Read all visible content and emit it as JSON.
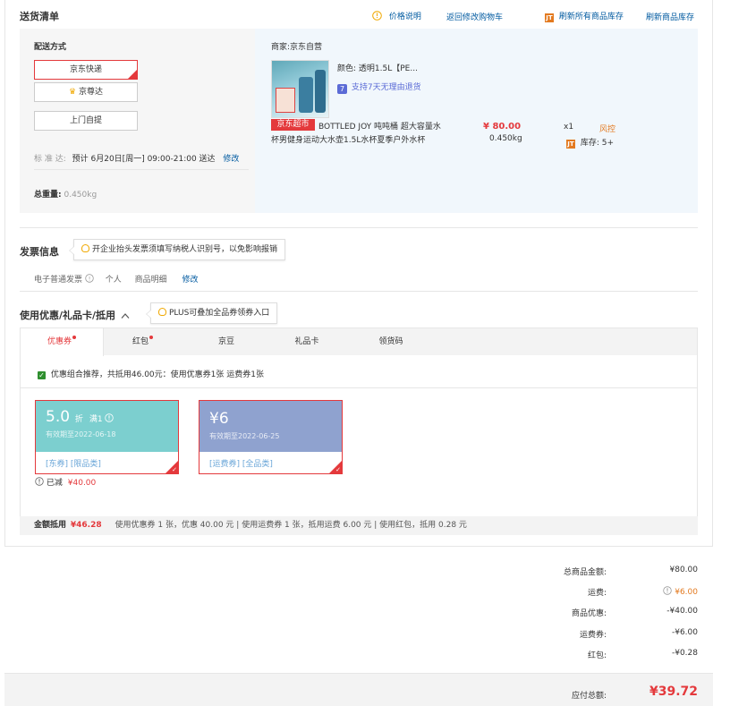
{
  "delivery": {
    "title": "送货清单",
    "links": {
      "price_desc": "价格说明",
      "back_to_cart": "返回修改购物车",
      "refresh_all_stock": "刷新所有商品库存",
      "refresh_stock": "刷新商品库存"
    },
    "shipping": {
      "label": "配送方式",
      "options": [
        "京东快递",
        "京尊达",
        "上门自提"
      ],
      "standard_label": "标 准 达:",
      "standard_time": "预计 6月20日[周一] 09:00-21:00 送达",
      "modify": "修改",
      "weight_label": "总重量:",
      "weight_value": "0.450kg"
    },
    "merchant": {
      "label": "商家:京东自营",
      "product": {
        "color_label": "颜色:",
        "color_value": "透明1.5L【PE...",
        "return_policy": "支持7天无理由退货",
        "badge": "京东超市",
        "name": "BOTTLED JOY 吨吨桶 超大容量水杯男健身运动大水壶1.5L水杯夏季户外水杯",
        "price": "¥ 80.00",
        "weight": "0.450kg",
        "qty": "x1",
        "risk": "风控",
        "stock_label": "库存:",
        "stock_value": "5+"
      }
    }
  },
  "invoice": {
    "title": "发票信息",
    "tip": "开企业抬头发票须填写纳税人识别号，以免影响报销",
    "type": "电子普通发票",
    "person": "个人",
    "detail": "商品明细",
    "modify": "修改"
  },
  "discount": {
    "title": "使用优惠/礼品卡/抵用",
    "tip": "PLUS可叠加全品券领券入口",
    "tabs": [
      "优惠券",
      "红包",
      "京豆",
      "礼品卡",
      "领货码"
    ],
    "combo_text": "优惠组合推荐，共抵用46.00元：使用优惠券1张 运费券1张",
    "coupons": [
      {
        "amount": "5.0",
        "unit": "折",
        "condition": "满1",
        "expiry": "有效期至2022-06-18",
        "tags": "[东券]  [限品类]",
        "color": "#7ccfcf"
      },
      {
        "amount": "¥6",
        "unit": "",
        "condition": "",
        "expiry": "有效期至2022-06-25",
        "tags": "[运费券]  [全品类]",
        "color": "#8fa2cf"
      }
    ],
    "reduced_label": "已减",
    "reduced_value": "¥40.00",
    "summary_label": "金额抵用",
    "summary_value": "¥46.28",
    "summary_detail": "使用优惠券 1 张，优惠 40.00 元  | 使用运费券 1 张，抵用运费 6.00 元  | 使用红包，抵用 0.28 元"
  },
  "totals": {
    "rows": [
      {
        "label": "总商品金额:",
        "value": "¥80.00"
      },
      {
        "label": "运费:",
        "value": "¥6.00"
      },
      {
        "label": "商品优惠:",
        "value": "-¥40.00"
      },
      {
        "label": "运费券:",
        "value": "-¥6.00"
      },
      {
        "label": "红包:",
        "value": "-¥0.28"
      }
    ],
    "pay_label": "应付总额:",
    "pay_value": "¥39.72"
  },
  "colors": {
    "accent": "#e4393c",
    "link": "#005aa0",
    "merchant_bg": "#f1f7fc",
    "orange": "#e37a20"
  }
}
